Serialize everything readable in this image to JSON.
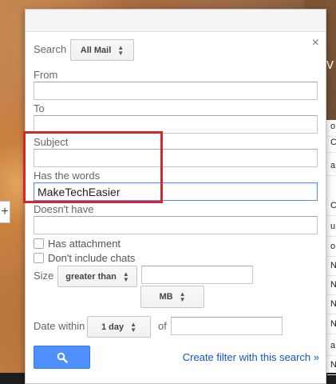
{
  "search": {
    "label": "Search",
    "scope_value": "All Mail"
  },
  "fields": {
    "from_label": "From",
    "to_label": "To",
    "subject_label": "Subject",
    "has_words_label": "Has the words",
    "has_words_value": "MakeTechEasier",
    "doesnt_have_label": "Doesn't have"
  },
  "options": {
    "has_attachment": "Has attachment",
    "no_chats": "Don't include chats"
  },
  "size": {
    "label": "Size",
    "operator": "greater than",
    "unit": "MB"
  },
  "date": {
    "label": "Date within",
    "range": "1 day",
    "of_label": "of"
  },
  "actions": {
    "create_filter": "Create filter with this search »",
    "close": "×"
  },
  "background": {
    "side_letters": [
      "o",
      "C",
      "a",
      "C",
      "u",
      "o",
      "N",
      "N",
      "N",
      "N",
      "a",
      "N"
    ],
    "plus": "+"
  },
  "colors": {
    "accent": "#4d90fe",
    "highlight": "#d0282c",
    "link": "#1155cc"
  }
}
